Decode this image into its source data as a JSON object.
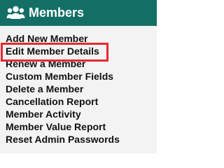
{
  "header": {
    "title": "Members",
    "icon": "members-icon",
    "background": "#136f66",
    "text_color": "#ffffff"
  },
  "menu": {
    "background": "#f3f3f3",
    "highlight_color": "#e52b33",
    "items": [
      {
        "label": "Add New Member"
      },
      {
        "label": "Edit Member Details"
      },
      {
        "label": "Renew a Member"
      },
      {
        "label": "Custom Member Fields"
      },
      {
        "label": "Delete a Member"
      },
      {
        "label": "Cancellation Report"
      },
      {
        "label": "Member Activity"
      },
      {
        "label": "Member Value Report"
      },
      {
        "label": "Reset Admin Passwords"
      }
    ]
  }
}
